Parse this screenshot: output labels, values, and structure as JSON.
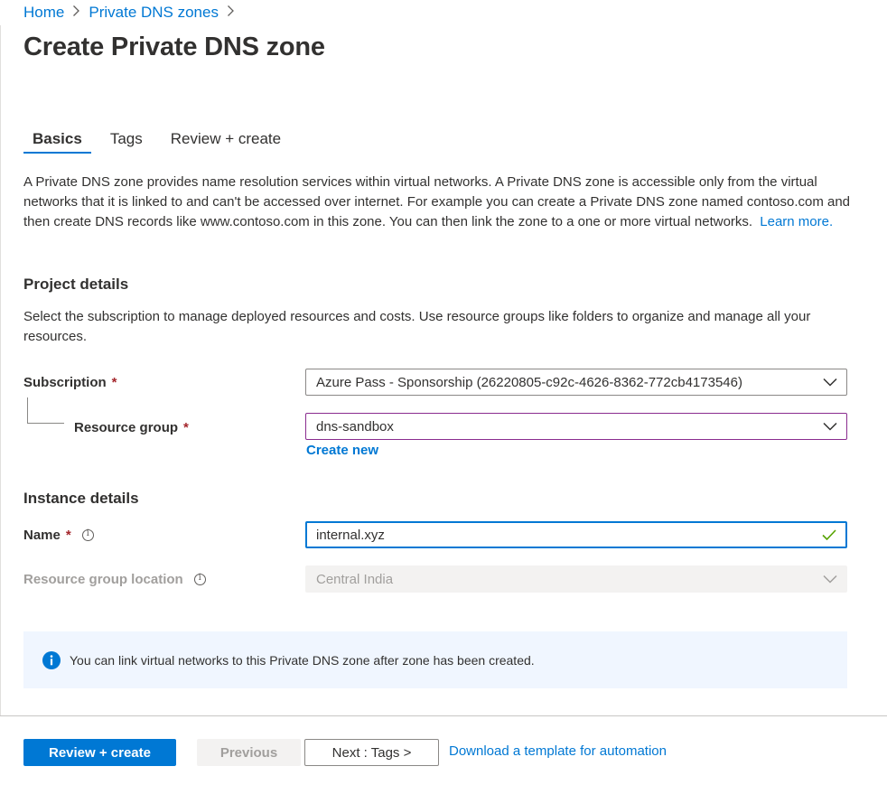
{
  "breadcrumb": {
    "home": "Home",
    "private_dns_zones": "Private DNS zones",
    "separator": ">"
  },
  "page": {
    "title": "Create Private DNS zone"
  },
  "tabs": [
    {
      "label": "Basics",
      "active": true
    },
    {
      "label": "Tags",
      "active": false
    },
    {
      "label": "Review + create",
      "active": false
    }
  ],
  "intro": {
    "text": "A Private DNS zone provides name resolution services within virtual networks. A Private DNS zone is accessible only from the virtual networks that it is linked to and can't be accessed over internet. For example you can create a Private DNS zone named contoso.com and then create DNS records like www.contoso.com in this zone. You can then link the zone to a one or more virtual networks.",
    "learn_more": "Learn more."
  },
  "project_details": {
    "title": "Project details",
    "description": "Select the subscription to manage deployed resources and costs. Use resource groups like folders to organize and manage all your resources.",
    "subscription_label": "Subscription",
    "subscription_value": "Azure Pass - Sponsorship (26220805-c92c-4626-8362-772cb4173546)",
    "resource_group_label": "Resource group",
    "resource_group_value": "dns-sandbox",
    "create_new": "Create new",
    "required_marker": "*"
  },
  "instance_details": {
    "title": "Instance details",
    "name_label": "Name",
    "name_value": "internal.xyz",
    "location_label": "Resource group location",
    "location_value": "Central India",
    "required_marker": "*"
  },
  "info_box": {
    "text": "You can link virtual networks to this Private DNS zone after zone has been created."
  },
  "footer": {
    "review_create": "Review + create",
    "previous": "Previous",
    "next": "Next : Tags >",
    "download_template": "Download a template for automation"
  },
  "colors": {
    "accent": "#0078d4",
    "required": "#a4262c",
    "valid_check": "#57a300",
    "focus_border": "#8a2c8f",
    "info_background": "#f0f6ff"
  },
  "icons": {
    "breadcrumb_separator": "chevron-right-icon",
    "dropdown": "chevron-down-icon",
    "valid": "checkmark-icon",
    "info": "info-circle-icon"
  }
}
